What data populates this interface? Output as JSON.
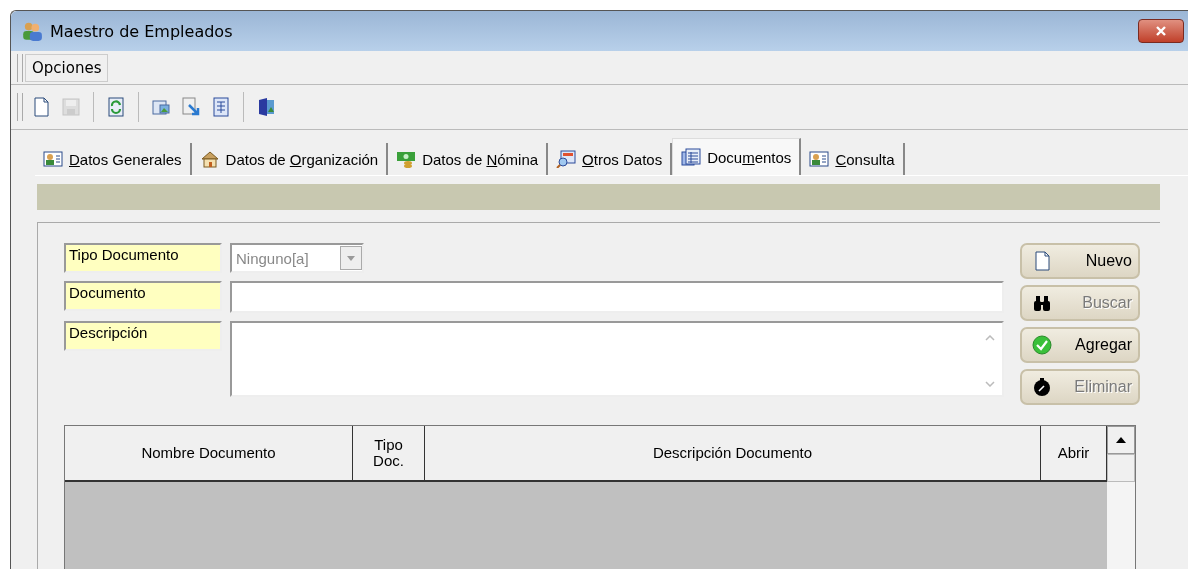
{
  "window": {
    "title": "Maestro de Empleados"
  },
  "menu": [
    {
      "label": "Opciones"
    }
  ],
  "toolbar": [
    {
      "kind": "new",
      "disabled": false
    },
    {
      "kind": "save",
      "disabled": true
    },
    {
      "kind": "separator"
    },
    {
      "kind": "refresh",
      "disabled": false
    },
    {
      "kind": "separator"
    },
    {
      "kind": "report",
      "disabled": false
    },
    {
      "kind": "export",
      "disabled": false
    },
    {
      "kind": "table",
      "disabled": false
    },
    {
      "kind": "separator"
    },
    {
      "kind": "exit",
      "disabled": false
    }
  ],
  "tabs": [
    {
      "kind": "general",
      "key": "D",
      "after": "atos Generales",
      "selected": false
    },
    {
      "kind": "organization",
      "before": "Datos de ",
      "key": "O",
      "after": "rganización",
      "selected": false
    },
    {
      "kind": "payroll",
      "before": "Datos de ",
      "key": "N",
      "after": "ómina",
      "selected": false
    },
    {
      "kind": "other",
      "key": "O",
      "after": "tros Datos",
      "selected": false
    },
    {
      "kind": "documents",
      "before": "Docu",
      "key": "m",
      "after": "entos",
      "selected": true
    },
    {
      "kind": "query",
      "key": "C",
      "after": "onsulta",
      "selected": false
    }
  ],
  "form": {
    "fields": [
      {
        "kind": "combo",
        "label": "Tipo Documento",
        "value": "Ninguno[a]"
      },
      {
        "kind": "text",
        "label": "Documento"
      },
      {
        "kind": "memo",
        "label": "Descripción"
      }
    ],
    "buttons": [
      {
        "kind": "new",
        "label": "Nuevo",
        "disabled": false
      },
      {
        "kind": "search",
        "label": "Buscar",
        "disabled": true
      },
      {
        "kind": "add",
        "label": "Agregar",
        "disabled": false
      },
      {
        "kind": "delete",
        "label": "Eliminar",
        "disabled": true
      }
    ]
  },
  "table": {
    "columns": [
      {
        "label": "Nombre Documento",
        "kind": "name"
      },
      {
        "label": "Tipo Doc.",
        "kind": "type"
      },
      {
        "label": "Descripción Documento",
        "kind": "desc"
      },
      {
        "label": "Abrir",
        "kind": "open"
      }
    ]
  }
}
